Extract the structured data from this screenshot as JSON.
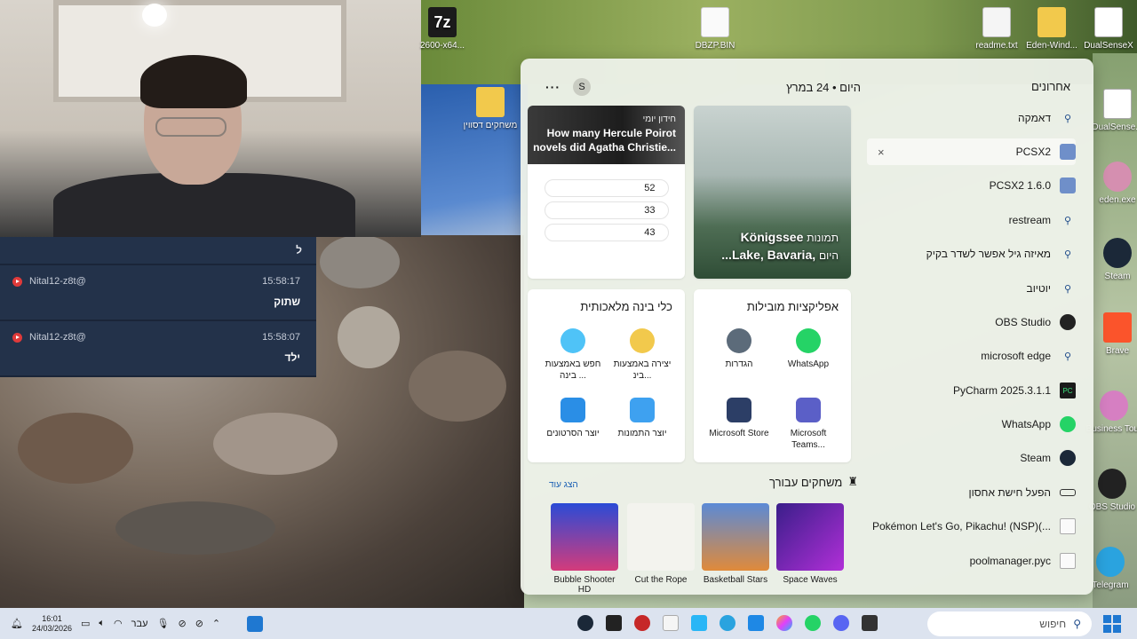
{
  "webcam": {},
  "chat": {
    "top_text": "ל",
    "messages": [
      {
        "user": "Nital12-z8t@",
        "time": "15:58:17",
        "text": "שתוק"
      },
      {
        "user": "Nital12-z8t@",
        "time": "15:58:07",
        "text": "ילד"
      }
    ]
  },
  "desktop_icons": [
    {
      "label": "2600-x64...",
      "icon": "7zip-installer-icon"
    },
    {
      "label": "DBZP.BIN",
      "icon": "file-icon"
    },
    {
      "label": "readme.txt",
      "icon": "text-file-icon"
    },
    {
      "label": "Eden-Wind...",
      "icon": "folder-icon"
    },
    {
      "label": "DualSenseX",
      "icon": "controller-icon"
    },
    {
      "label": "משחקים\nדסווין",
      "icon": "folder-icon"
    },
    {
      "label": "DualSense...",
      "icon": "controller-icon"
    },
    {
      "label": "eden.exe",
      "icon": "eden-app-icon"
    },
    {
      "label": "Steam",
      "icon": "steam-icon"
    },
    {
      "label": "Brave",
      "icon": "brave-icon"
    },
    {
      "label": "Business Tour",
      "icon": "game-icon"
    },
    {
      "label": "OBS Studio",
      "icon": "obs-icon"
    },
    {
      "label": "Telegram",
      "icon": "telegram-icon"
    }
  ],
  "panel": {
    "more_label": "···",
    "avatar_letter": "S",
    "date": "היום • 24 במרץ",
    "quiz": {
      "tag": "חידון יומי",
      "title": "How many Hercule Poirot novels did Agatha Christie...",
      "options": [
        "52",
        "33",
        "43"
      ]
    },
    "photo": {
      "caption": "Königssee תמונות\nLake, Bavaria, היום...",
      "line1": "Königssee",
      "line1_tag": "תמונות",
      "line2": "...Lake, Bavaria,",
      "line2_tag": "היום"
    },
    "ai_tools": {
      "title": "כלי בינה מלאכותית",
      "items": [
        {
          "label": "יצירה באמצעות בינ...",
          "icon": "ai-create-icon"
        },
        {
          "label": "חפש באמצעות בינה ...",
          "icon": "ai-search-icon"
        },
        {
          "label": "יוצר התמונות",
          "icon": "image-creator-icon"
        },
        {
          "label": "יוצר הסרטונים",
          "icon": "video-creator-icon"
        }
      ]
    },
    "top_apps": {
      "title": "אפליקציות מובילות",
      "items": [
        {
          "label": "WhatsApp",
          "icon": "whatsapp-icon"
        },
        {
          "label": "הגדרות",
          "icon": "settings-gear-icon"
        },
        {
          "label": "Microsoft Teams...",
          "icon": "teams-icon"
        },
        {
          "label": "Microsoft Store",
          "icon": "store-icon"
        }
      ]
    },
    "games": {
      "title": "משחקים עבורך",
      "show_more": "הצג עוד",
      "items": [
        {
          "label": "Space Waves",
          "icon": "space-waves-icon"
        },
        {
          "label": "Basketball Stars",
          "icon": "basketball-stars-icon"
        },
        {
          "label": "Cut the Rope",
          "icon": "cut-the-rope-icon"
        },
        {
          "label": "Bubble Shooter HD",
          "icon": "bubble-shooter-icon"
        }
      ]
    },
    "recent": {
      "title": "אחרונים",
      "items": [
        {
          "label": "דאמקה",
          "icon": "search-icon"
        },
        {
          "label": "PCSX2",
          "icon": "pcsx2-icon",
          "selected": true
        },
        {
          "label": "PCSX2 1.6.0",
          "icon": "pcsx2-icon"
        },
        {
          "label": "restream",
          "icon": "search-icon"
        },
        {
          "label": "מאיזה גיל אפשר לשדר בקיק",
          "icon": "search-icon"
        },
        {
          "label": "יוטיוב",
          "icon": "search-icon"
        },
        {
          "label": "OBS Studio",
          "icon": "obs-icon"
        },
        {
          "label": "microsoft edge",
          "icon": "search-icon"
        },
        {
          "label": "PyCharm 2025.3.1.1",
          "icon": "pycharm-icon"
        },
        {
          "label": "WhatsApp",
          "icon": "whatsapp-icon"
        },
        {
          "label": "Steam",
          "icon": "steam-icon"
        },
        {
          "label": "הפעל חישת אחסון",
          "icon": "storage-icon"
        },
        {
          "label": "Pokémon Let's Go, Pikachu! (NSP)(...",
          "icon": "file-icon"
        },
        {
          "label": "poolmanager.pyc",
          "icon": "file-icon"
        }
      ]
    }
  },
  "taskbar": {
    "time": "16:01",
    "date": "24/03/2026",
    "lang": "עבר",
    "search_placeholder": "חיפוש",
    "apps": [
      "steam-icon",
      "app-icon",
      "app-icon",
      "file-icon",
      "app-icon",
      "telegram-icon",
      "store-icon",
      "copilot-icon",
      "whatsapp-icon",
      "discord-icon",
      "app-icon"
    ]
  },
  "colors": {
    "chat_bg": "#23324a",
    "accent": "#1a5fb4",
    "panel_bg": "#ecf0e8",
    "taskbar_bg": "#dce3ef"
  }
}
